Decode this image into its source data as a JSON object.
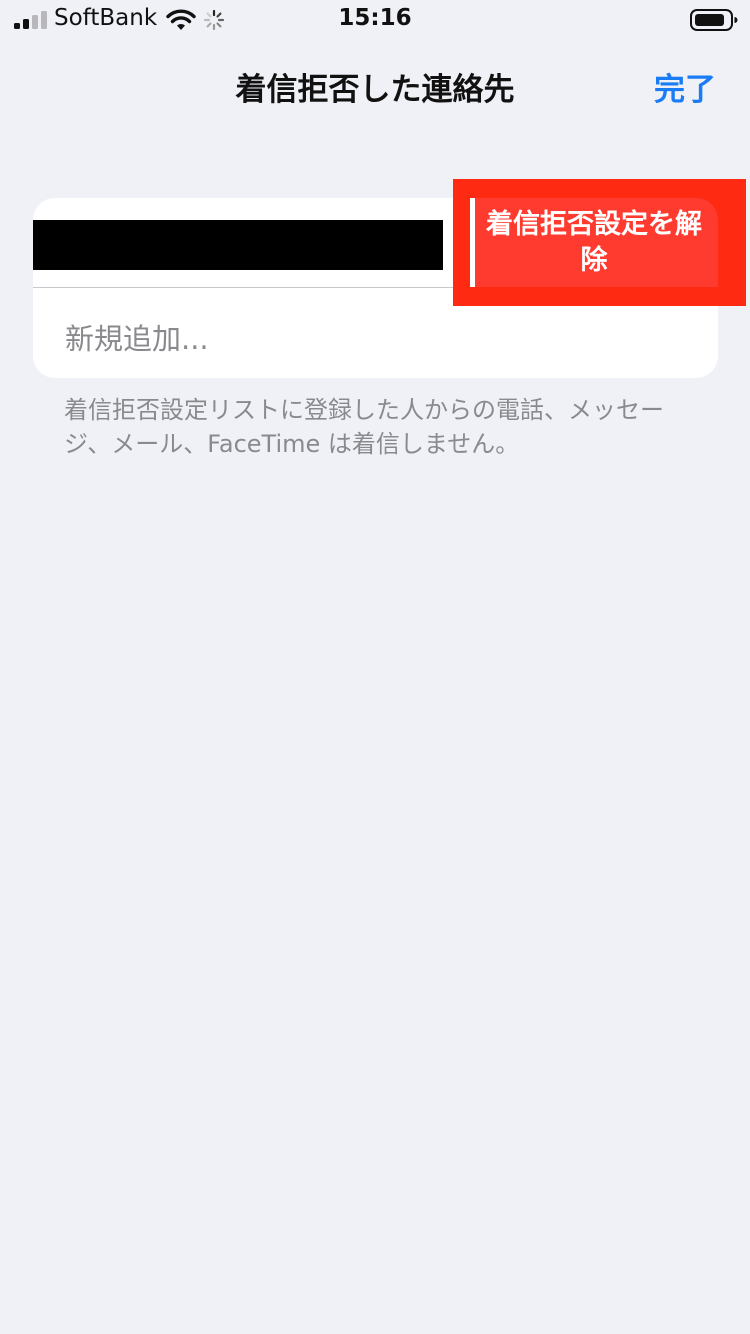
{
  "status_bar": {
    "carrier": "SoftBank",
    "time": "15:16"
  },
  "nav": {
    "title": "着信拒否した連絡先",
    "done_label": "完了"
  },
  "blocked_list": {
    "unblock_label": "着信拒否設定を解除",
    "add_new_label": "新規追加..."
  },
  "footer_note": "着信拒否設定リストに登録した人からの電話、メッセージ、メール、FaceTime は着信しません。",
  "colors": {
    "accent": "#1a7cf5",
    "destructive": "#ff3b30",
    "highlight": "#ff2a12",
    "background": "#f0f1f6"
  }
}
